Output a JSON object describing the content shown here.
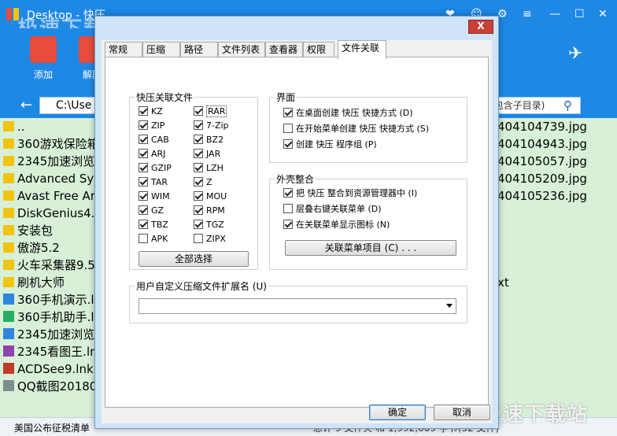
{
  "background": {
    "window_title": "Desktop - 快压",
    "watermark_top": "极速下载站",
    "watermark_bottom": "极速下载站",
    "toolbar": [
      {
        "label": "添加",
        "color": "#e74c3c"
      },
      {
        "label": "解压",
        "color": "#e74c3c"
      }
    ],
    "address": {
      "path": "C:\\Use",
      "search_placeholder": "(包含子目录)"
    },
    "files_left": [
      "..",
      "360游戏保险箱",
      "2345加速浏览",
      "Advanced Sys",
      "Avast Free Ar",
      "DiskGenius4.9",
      "安装包",
      "傲游5.2",
      "火车采集器9.5",
      "刷机大师",
      "360手机演示.l",
      "360手机助手.l",
      "2345加速浏览",
      "2345看图王.ln",
      "ACDSee9.lnk",
      "QQ截图20180"
    ],
    "files_right": [
      "404104739.jpg",
      "404104943.jpg",
      "404105057.jpg",
      "404105209.jpg",
      "404105236.jpg",
      "",
      "",
      "",
      "",
      "xt"
    ],
    "status": {
      "left": "美国公布征税清单",
      "right": "总计 9 文件夹 和 1,992,609 字节(32 文件)"
    }
  },
  "dialog": {
    "close_label": "X",
    "tabs": [
      "常规",
      "压缩",
      "路径",
      "文件列表",
      "查看器",
      "权限",
      "文件关联"
    ],
    "active_tab": "文件关联",
    "assoc_group": {
      "title": "快压关联文件",
      "left_col": [
        {
          "label": "KZ",
          "checked": true
        },
        {
          "label": "ZIP",
          "checked": true
        },
        {
          "label": "CAB",
          "checked": true
        },
        {
          "label": "ARJ",
          "checked": true
        },
        {
          "label": "GZIP",
          "checked": true
        },
        {
          "label": "TAR",
          "checked": true
        },
        {
          "label": "WIM",
          "checked": true
        },
        {
          "label": "GZ",
          "checked": true
        },
        {
          "label": "TBZ",
          "checked": true
        },
        {
          "label": "APK",
          "checked": false
        }
      ],
      "right_col": [
        {
          "label": "RAR",
          "checked": true
        },
        {
          "label": "7-Zip",
          "checked": true
        },
        {
          "label": "BZ2",
          "checked": true
        },
        {
          "label": "JAR",
          "checked": true
        },
        {
          "label": "LZH",
          "checked": true
        },
        {
          "label": "Z",
          "checked": true
        },
        {
          "label": "MOU",
          "checked": true
        },
        {
          "label": "RPM",
          "checked": true
        },
        {
          "label": "TGZ",
          "checked": true
        },
        {
          "label": "ZIPX",
          "checked": false
        }
      ],
      "select_all": "全部选择"
    },
    "interface_group": {
      "title": "界面",
      "items": [
        {
          "label": "在桌面创建 快压 快捷方式 (D)",
          "checked": true
        },
        {
          "label": "在开始菜单创建 快压 快捷方式 (S)",
          "checked": false
        },
        {
          "label": "创建 快压 程序组 (P)",
          "checked": true
        }
      ]
    },
    "shell_group": {
      "title": "外壳整合",
      "items": [
        {
          "label": "把 快压 整合到资源管理器中 (I)",
          "checked": true
        },
        {
          "label": "层叠右键关联菜单 (D)",
          "checked": false
        },
        {
          "label": "在关联菜单显示图标 (N)",
          "checked": true
        }
      ],
      "menu_button": "关联菜单项目 (C) . . ."
    },
    "custom_group": {
      "title": "用户自定义压缩文件扩展名 (U)",
      "value": ""
    },
    "ok": "确定",
    "cancel": "取消"
  }
}
